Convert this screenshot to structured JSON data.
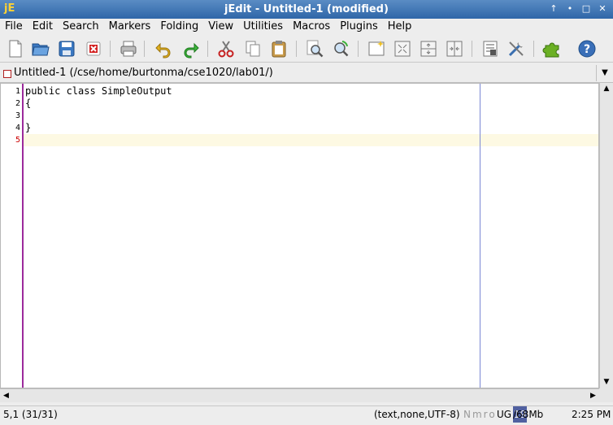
{
  "window": {
    "title": "jEdit - Untitled-1 (modified)",
    "app_icon_glyph": "jE",
    "buttons": [
      "↑",
      "•",
      "□",
      "✕"
    ]
  },
  "menubar": [
    "File",
    "Edit",
    "Search",
    "Markers",
    "Folding",
    "View",
    "Utilities",
    "Macros",
    "Plugins",
    "Help"
  ],
  "toolbar": {
    "icons": [
      "new-file-icon",
      "open-file-icon",
      "save-file-icon",
      "close-file-icon",
      "print-icon",
      "undo-icon",
      "redo-icon",
      "cut-icon",
      "copy-icon",
      "paste-icon",
      "find-icon",
      "find-replace-icon",
      "new-view-icon",
      "split-vertical-icon",
      "split-horizontal-icon",
      "unsplit-icon",
      "buffer-options-icon",
      "global-options-icon",
      "plugin-manager-icon",
      "help-icon"
    ]
  },
  "buffer": {
    "label": "Untitled-1 (/cse/home/burtonma/cse1020/lab01/)"
  },
  "editor": {
    "line_numbers": [
      "1",
      "2",
      "3",
      "4",
      "5"
    ],
    "lines": [
      "public class SimpleOutput",
      "{",
      "",
      "}",
      ""
    ],
    "current_line": 5
  },
  "status": {
    "caret": "5,1 (31/31)",
    "mode": "(text,none,UTF-8)",
    "flags": "Nmro",
    "ug": "UG",
    "mem_used": "19",
    "mem_total": "/68Mb",
    "time": "2:25 PM"
  },
  "colors": {
    "titlebar": "#2f66a8",
    "gutter_border": "#9c2a9c",
    "current_line_number": "#cc0000",
    "wrap_guide": "#7b88d4",
    "current_line_highlight": "#fdf9e3"
  }
}
